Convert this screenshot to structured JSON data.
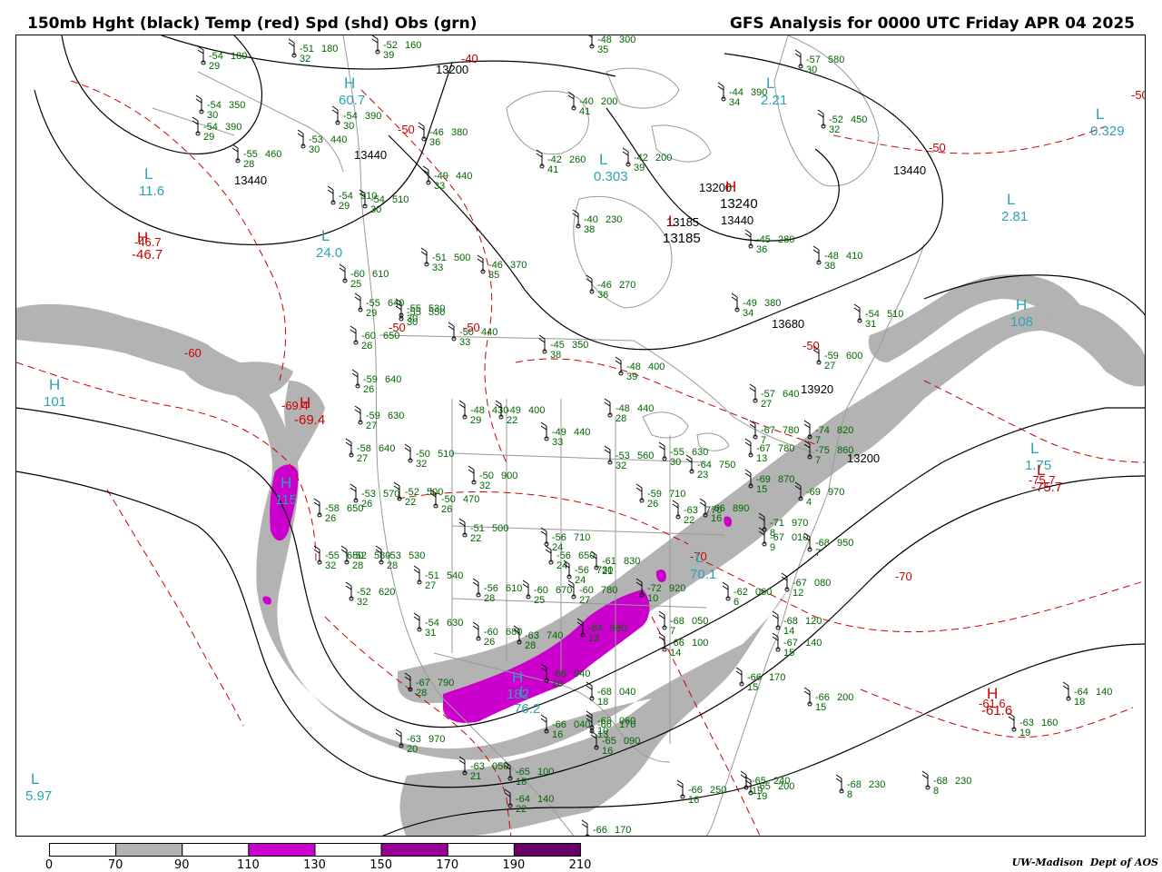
{
  "header": {
    "title_left": "150mb Hght (black) Temp (red) Spd (shd) Obs (grn)",
    "title_right": "GFS Analysis for 0000 UTC Friday  APR 04 2025"
  },
  "legend": {
    "ticks": [
      "0",
      "70",
      "90",
      "110",
      "130",
      "150",
      "170",
      "190",
      "210"
    ],
    "fills": [
      "#ffffff",
      "#b3b3b3",
      "#ffffff",
      "#cc00cc",
      "#ffffff",
      "#99009a",
      "#ffffff",
      "#660066"
    ]
  },
  "credit": {
    "org": "UW-Madison",
    "dept": "Dept of AOS"
  },
  "colors": {
    "height_contour": "#000000",
    "temperature": "#cc0000",
    "speed_shade_70": "#b3b3b3",
    "speed_shade_110": "#cc00cc",
    "observations": "#006600",
    "centers": "#2ba3b3",
    "borders": "#999999"
  },
  "height_labels": [
    "13200",
    "13440",
    "13440",
    "13440",
    "13200",
    "13185",
    "13440",
    "13680",
    "13920",
    "13200"
  ],
  "temp_labels": [
    "-40",
    "-50",
    "-60",
    "-50",
    "-50",
    "-50",
    "-50",
    "-50",
    "-70",
    "-70",
    "-69.4",
    "-75.7",
    "-61.6",
    "-46.7"
  ],
  "centers": [
    {
      "type": "H",
      "value": "60.7"
    },
    {
      "type": "L",
      "value": "11.6"
    },
    {
      "type": "L",
      "value": "24.0"
    },
    {
      "type": "H",
      "value": "101"
    },
    {
      "type": "H",
      "value": "115"
    },
    {
      "type": "L",
      "value": "5.97"
    },
    {
      "type": "L",
      "value": "0.303"
    },
    {
      "type": "L",
      "value": "2.21"
    },
    {
      "type": "L",
      "value": "0.329"
    },
    {
      "type": "L",
      "value": "2.81"
    },
    {
      "type": "H",
      "value": "108"
    },
    {
      "type": "L",
      "value": "1.75"
    },
    {
      "type": "H",
      "value": "182"
    },
    {
      "type": "L",
      "value": "70.1"
    },
    {
      "type": "L",
      "value": "76.2"
    },
    {
      "type": "H",
      "value": "-46.7"
    },
    {
      "type": "H",
      "value": "-61.6"
    },
    {
      "type": "L",
      "value": "-75.7"
    },
    {
      "type": "H",
      "value": "-69.4"
    },
    {
      "type": "L",
      "value": "13185"
    },
    {
      "type": "H",
      "value": "13240"
    }
  ],
  "observations": [
    {
      "t": "-54",
      "h": "180",
      "d": "29"
    },
    {
      "t": "-51",
      "h": "180",
      "d": "32"
    },
    {
      "t": "-52",
      "h": "160",
      "d": "39"
    },
    {
      "t": "-48",
      "h": "300",
      "d": "35"
    },
    {
      "t": "-54",
      "h": "350",
      "d": "30"
    },
    {
      "t": "-54",
      "h": "390",
      "d": "30"
    },
    {
      "t": "-54",
      "h": "390",
      "d": "29"
    },
    {
      "t": "-53",
      "h": "440",
      "d": "30"
    },
    {
      "t": "-55",
      "h": "460",
      "d": "28"
    },
    {
      "t": "-46",
      "h": "380",
      "d": "36"
    },
    {
      "t": "-40",
      "h": "200",
      "d": "41"
    },
    {
      "t": "-42",
      "h": "260",
      "d": "41"
    },
    {
      "t": "-42",
      "h": "200",
      "d": "39"
    },
    {
      "t": "-49",
      "h": "440",
      "d": "33"
    },
    {
      "t": "-57",
      "h": "580",
      "d": "30"
    },
    {
      "t": "-44",
      "h": "390",
      "d": "34"
    },
    {
      "t": "-52",
      "h": "450",
      "d": "32"
    },
    {
      "t": "-54",
      "h": "510",
      "d": "29"
    },
    {
      "t": "-54",
      "h": "510",
      "d": "30"
    },
    {
      "t": "-40",
      "h": "230",
      "d": "38"
    },
    {
      "t": "-45",
      "h": "280",
      "d": "36"
    },
    {
      "t": "-51",
      "h": "500",
      "d": "33"
    },
    {
      "t": "-46",
      "h": "370",
      "d": "35"
    },
    {
      "t": "-60",
      "h": "610",
      "d": "25"
    },
    {
      "t": "-46",
      "h": "270",
      "d": "36"
    },
    {
      "t": "-48",
      "h": "410",
      "d": "38"
    },
    {
      "t": "-55",
      "h": "530",
      "d": "30"
    },
    {
      "t": "-55",
      "h": "550",
      "d": "30"
    },
    {
      "t": "-55",
      "h": "640",
      "d": "29"
    },
    {
      "t": "-49",
      "h": "380",
      "d": "34"
    },
    {
      "t": "-54",
      "h": "510",
      "d": "31"
    },
    {
      "t": "-50",
      "h": "440",
      "d": "33"
    },
    {
      "t": "-60",
      "h": "650",
      "d": "26"
    },
    {
      "t": "-45",
      "h": "350",
      "d": "38"
    },
    {
      "t": "-59",
      "h": "600",
      "d": "27"
    },
    {
      "t": "-48",
      "h": "400",
      "d": "39"
    },
    {
      "t": "-59",
      "h": "640",
      "d": "26"
    },
    {
      "t": "-59",
      "h": "630",
      "d": "27"
    },
    {
      "t": "-48",
      "h": "430",
      "d": "29"
    },
    {
      "t": "-49",
      "h": "400",
      "d": "22"
    },
    {
      "t": "-48",
      "h": "440",
      "d": "28"
    },
    {
      "t": "-49",
      "h": "440",
      "d": "33"
    },
    {
      "t": "-57",
      "h": "640",
      "d": "27"
    },
    {
      "t": "-67",
      "h": "780",
      "d": "7"
    },
    {
      "t": "-58",
      "h": "640",
      "d": "27"
    },
    {
      "t": "-50",
      "h": "510",
      "d": "32"
    },
    {
      "t": "-53",
      "h": "560",
      "d": "32"
    },
    {
      "t": "-55",
      "h": "630",
      "d": "30"
    },
    {
      "t": "-74",
      "h": "820",
      "d": "7"
    },
    {
      "t": "-67",
      "h": "780",
      "d": "13"
    },
    {
      "t": "-75",
      "h": "860",
      "d": "7"
    },
    {
      "t": "-50",
      "h": "900",
      "d": "32"
    },
    {
      "t": "-64",
      "h": "750",
      "d": "23"
    },
    {
      "t": "-53",
      "h": "570",
      "d": "26"
    },
    {
      "t": "-52",
      "h": "500",
      "d": "22"
    },
    {
      "t": "-50",
      "h": "470",
      "d": "26"
    },
    {
      "t": "-58",
      "h": "650",
      "d": "26"
    },
    {
      "t": "-59",
      "h": "710",
      "d": "26"
    },
    {
      "t": "-69",
      "h": "870",
      "d": "15"
    },
    {
      "t": "-69",
      "h": "970",
      "d": "4"
    },
    {
      "t": "-66",
      "h": "890",
      "d": "16"
    },
    {
      "t": "-63",
      "h": "770",
      "d": "22"
    },
    {
      "t": "-51",
      "h": "500",
      "d": "22"
    },
    {
      "t": "-71",
      "h": "970",
      "d": "8"
    },
    {
      "t": "-67",
      "h": "010",
      "d": "9"
    },
    {
      "t": "-68",
      "h": "950",
      "d": "7"
    },
    {
      "t": "-55",
      "h": "650",
      "d": "32"
    },
    {
      "t": "-52",
      "h": "580",
      "d": "28"
    },
    {
      "t": "-53",
      "h": "530",
      "d": "28"
    },
    {
      "t": "-56",
      "h": "710",
      "d": "24"
    },
    {
      "t": "-56",
      "h": "650",
      "d": "24"
    },
    {
      "t": "-61",
      "h": "830",
      "d": "21"
    },
    {
      "t": "-56",
      "h": "730",
      "d": "24"
    },
    {
      "t": "-51",
      "h": "540",
      "d": "27"
    },
    {
      "t": "-52",
      "h": "620",
      "d": "32"
    },
    {
      "t": "-56",
      "h": "610",
      "d": "28"
    },
    {
      "t": "-60",
      "h": "670",
      "d": "25"
    },
    {
      "t": "-60",
      "h": "780",
      "d": "27"
    },
    {
      "t": "-72",
      "h": "920",
      "d": "10"
    },
    {
      "t": "-67",
      "h": "080",
      "d": "12"
    },
    {
      "t": "-62",
      "h": "060",
      "d": "6"
    },
    {
      "t": "-68",
      "h": "120",
      "d": "14"
    },
    {
      "t": "-54",
      "h": "630",
      "d": "31"
    },
    {
      "t": "-60",
      "h": "680",
      "d": "26"
    },
    {
      "t": "-63",
      "h": "740",
      "d": "28"
    },
    {
      "t": "-64",
      "h": "980",
      "d": "13"
    },
    {
      "t": "-68",
      "h": "050",
      "d": "7"
    },
    {
      "t": "-67",
      "h": "140",
      "d": "15"
    },
    {
      "t": "-67",
      "h": "790",
      "d": "28"
    },
    {
      "t": "-66",
      "h": "940",
      "d": "10"
    },
    {
      "t": "-68",
      "h": "040",
      "d": "18"
    },
    {
      "t": "-66",
      "h": "100",
      "d": "14"
    },
    {
      "t": "-66",
      "h": "170",
      "d": "15"
    },
    {
      "t": "-66",
      "h": "170",
      "d": "13"
    },
    {
      "t": "-66",
      "h": "040",
      "d": "16"
    },
    {
      "t": "-65",
      "h": "090",
      "d": "16"
    },
    {
      "t": "-66",
      "h": "060",
      "d": "10"
    },
    {
      "t": "-66",
      "h": "200",
      "d": "15"
    },
    {
      "t": "-64",
      "h": "140",
      "d": "18"
    },
    {
      "t": "-63",
      "h": "160",
      "d": "19"
    },
    {
      "t": "-63",
      "h": "970",
      "d": "20"
    },
    {
      "t": "-63",
      "h": "050",
      "d": "21"
    },
    {
      "t": "-65",
      "h": "100",
      "d": "18"
    },
    {
      "t": "-64",
      "h": "140",
      "d": "22"
    },
    {
      "t": "-66",
      "h": "170",
      "d": "20"
    },
    {
      "t": "-65",
      "h": "200",
      "d": "19"
    },
    {
      "t": "-66",
      "h": "250",
      "d": "16"
    },
    {
      "t": "-65",
      "h": "240",
      "d": "19"
    },
    {
      "t": "-68",
      "h": "230",
      "d": "8"
    },
    {
      "t": "-68",
      "h": "230",
      "d": "8"
    }
  ]
}
